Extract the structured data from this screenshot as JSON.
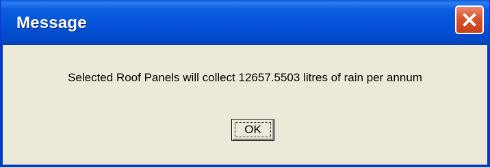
{
  "window": {
    "title": "Message",
    "close_icon": "close-icon"
  },
  "dialog": {
    "message": "Selected Roof Panels will collect 12657.5503 litres of rain per annum",
    "ok_label": "OK"
  },
  "colors": {
    "titlebar": "#0450d6",
    "close_button": "#d7542f",
    "dialog_background": "#ece9d8"
  }
}
